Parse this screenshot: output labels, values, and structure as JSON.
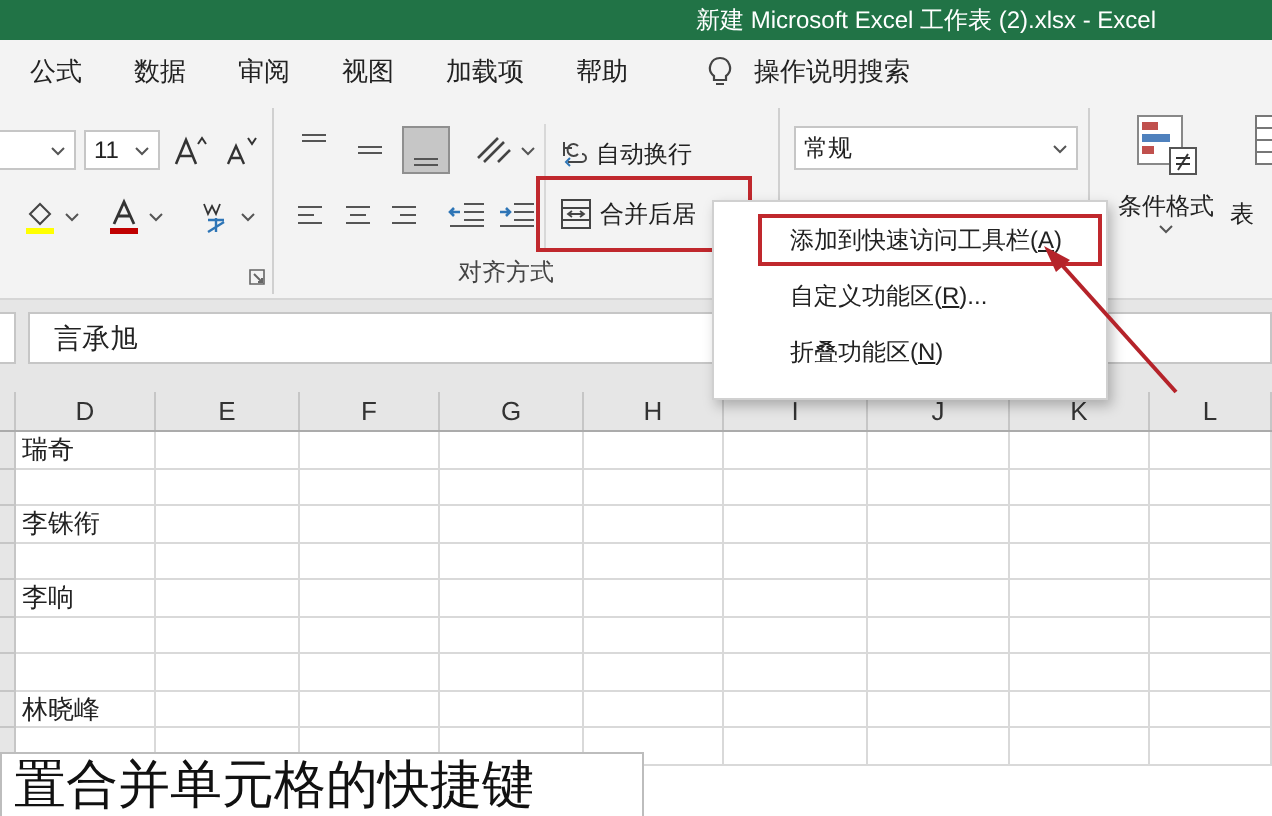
{
  "title_bar": {
    "title": "新建 Microsoft Excel 工作表 (2).xlsx  -  Excel"
  },
  "tabs": [
    {
      "label": "公式"
    },
    {
      "label": "数据"
    },
    {
      "label": "审阅"
    },
    {
      "label": "视图"
    },
    {
      "label": "加载项"
    },
    {
      "label": "帮助"
    }
  ],
  "tell_me": {
    "label": "操作说明搜索"
  },
  "ribbon": {
    "font_size": "11",
    "vertical_align": [
      {
        "selected": false
      },
      {
        "selected": false
      },
      {
        "selected": true
      }
    ],
    "wrap_text": "自动换行",
    "merge_center": {
      "label": "合并后居",
      "outlined": true
    },
    "alignment_group_label": "对齐方式",
    "number_format": "常规",
    "conditional_format": "条件格式",
    "table_format": [
      "表"
    ]
  },
  "formula_bar": {
    "value": "言承旭"
  },
  "sheet": {
    "columns": [
      "D",
      "E",
      "F",
      "G",
      "H",
      "I",
      "J",
      "K",
      "L"
    ],
    "rows": [
      {
        "D": "瑞奇"
      },
      {},
      {
        "D": "李铢衔"
      },
      {},
      {
        "D": "李响"
      },
      {},
      {},
      {
        "D": "林晓峰"
      },
      {}
    ]
  },
  "context_menu": {
    "items": [
      {
        "label": "添加到快速访问工具栏(A)",
        "outlined": true
      },
      {
        "label": "自定义功能区(R)...",
        "outlined": false
      },
      {
        "label": "折叠功能区(N)",
        "outlined": false
      }
    ]
  },
  "caption": {
    "text": "置合并单元格的快捷键"
  }
}
